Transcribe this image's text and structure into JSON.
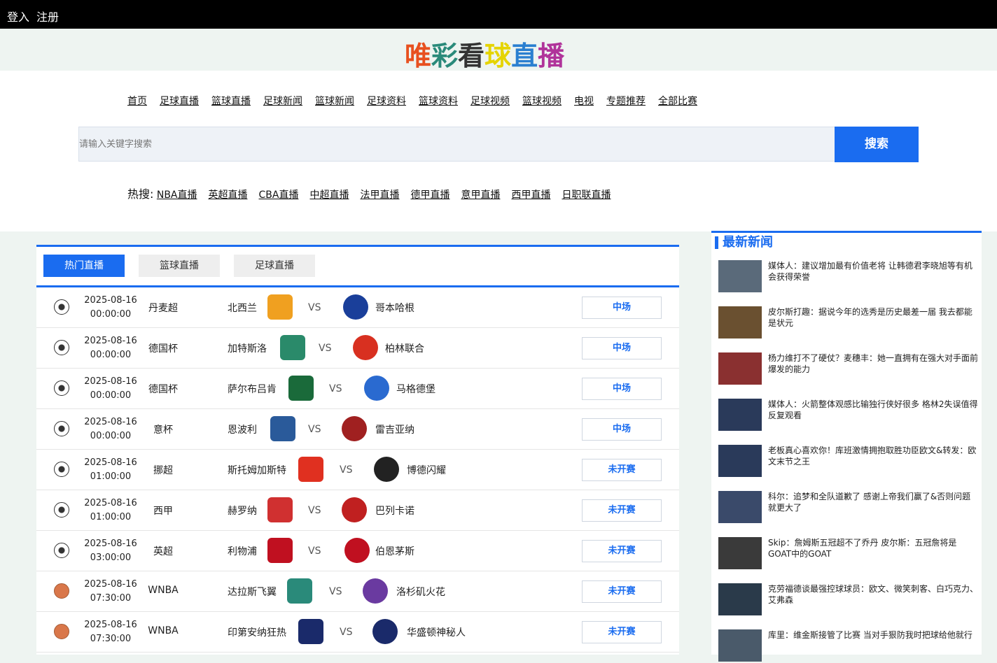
{
  "topbar": {
    "login": "登入",
    "register": "注册"
  },
  "logo": {
    "chars": [
      "唯",
      "彩",
      "看",
      "球",
      "直",
      "播"
    ],
    "colors": [
      "#e8501f",
      "#2a8a7a",
      "#333333",
      "#e5d400",
      "#2a7fd0",
      "#b0339a"
    ]
  },
  "nav": [
    "首页",
    "足球直播",
    "篮球直播",
    "足球新闻",
    "篮球新闻",
    "足球资料",
    "篮球资料",
    "足球视频",
    "篮球视频",
    "电视",
    "专题推荐",
    "全部比赛"
  ],
  "search": {
    "placeholder": "请输入关键字搜索",
    "button": "搜索"
  },
  "hot": {
    "label": "热搜:",
    "items": [
      "NBA直播",
      "英超直播",
      "CBA直播",
      "中超直播",
      "法甲直播",
      "德甲直播",
      "意甲直播",
      "西甲直播",
      "日职联直播"
    ]
  },
  "tabs": [
    "热门直播",
    "篮球直播",
    "足球直播"
  ],
  "matches": [
    {
      "sport": "soccer-ball-icon",
      "date": "2025-08-16",
      "time": "00:00:00",
      "league": "丹麦超",
      "home": "北西兰",
      "away": "哥本哈根",
      "status": "中场",
      "vs": "VS"
    },
    {
      "sport": "soccer-ball-icon",
      "date": "2025-08-16",
      "time": "00:00:00",
      "league": "德国杯",
      "home": "加特斯洛",
      "away": "柏林联合",
      "status": "中场",
      "vs": "VS"
    },
    {
      "sport": "soccer-ball-icon",
      "date": "2025-08-16",
      "time": "00:00:00",
      "league": "德国杯",
      "home": "萨尔布吕肯",
      "away": "马格德堡",
      "status": "中场",
      "vs": "VS"
    },
    {
      "sport": "soccer-ball-icon",
      "date": "2025-08-16",
      "time": "00:00:00",
      "league": "意杯",
      "home": "恩波利",
      "away": "雷吉亚纳",
      "status": "中场",
      "vs": "VS"
    },
    {
      "sport": "soccer-ball-icon",
      "date": "2025-08-16",
      "time": "01:00:00",
      "league": "挪超",
      "home": "斯托姆加斯特",
      "away": "博德闪耀",
      "status": "未开赛",
      "vs": "VS"
    },
    {
      "sport": "soccer-ball-icon",
      "date": "2025-08-16",
      "time": "01:00:00",
      "league": "西甲",
      "home": "赫罗纳",
      "away": "巴列卡诺",
      "status": "未开赛",
      "vs": "VS"
    },
    {
      "sport": "soccer-ball-icon",
      "date": "2025-08-16",
      "time": "03:00:00",
      "league": "英超",
      "home": "利物浦",
      "away": "伯恩茅斯",
      "status": "未开赛",
      "vs": "VS"
    },
    {
      "sport": "basketball-icon",
      "date": "2025-08-16",
      "time": "07:30:00",
      "league": "WNBA",
      "home": "达拉斯飞翼",
      "away": "洛杉矶火花",
      "status": "未开赛",
      "vs": "VS"
    },
    {
      "sport": "basketball-icon",
      "date": "2025-08-16",
      "time": "07:30:00",
      "league": "WNBA",
      "home": "印第安纳狂热",
      "away": "华盛顿神秘人",
      "status": "未开赛",
      "vs": "VS"
    }
  ],
  "crest_colors": [
    [
      "#f0a020",
      "#1a3f9a"
    ],
    [
      "#2a8a6a",
      "#d83020"
    ],
    [
      "#1a6a3a",
      "#2a6ad0"
    ],
    [
      "#2a5a9a",
      "#a02020"
    ],
    [
      "#e03020",
      "#222222"
    ],
    [
      "#d03030",
      "#c02020"
    ],
    [
      "#c01020",
      "#c01020"
    ],
    [
      "#2a8a7a",
      "#6a3aa0"
    ],
    [
      "#1a2a6a",
      "#1a2a6a"
    ]
  ],
  "news_title": "最新新闻",
  "news": [
    "媒体人：建议增加最有价值老将 让韩德君李晓旭等有机会获得荣誉",
    "皮尔斯打趣：据说今年的选秀是历史最差一届 我去都能是状元",
    "杨力维打不了硬仗？麦穗丰：她一直拥有在强大对手面前爆发的能力",
    "媒体人：火箭整体观感比输独行侠好很多 格林2失误值得反复观看",
    "老板真心喜欢你！库班激情拥抱取胜功臣欧文&转发：欧文末节之王",
    "科尔：追梦和全队道歉了 感谢上帝我们赢了&否则问题就更大了",
    "Skip：詹姆斯五冠超不了乔丹 皮尔斯：五冠詹将是GOAT中的GOAT",
    "克劳福德谈最强控球球员：欧文、微笑刺客、白巧克力、艾弗森",
    "库里：维金斯接管了比赛 当对手狠防我时把球给他就行"
  ]
}
